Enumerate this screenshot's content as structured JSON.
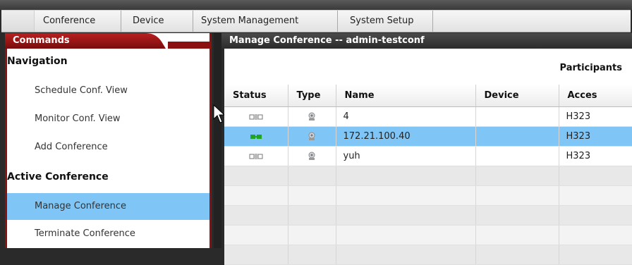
{
  "menu": {
    "items": [
      "Conference",
      "Device",
      "System Management",
      "System Setup"
    ]
  },
  "commands": {
    "title": "Commands",
    "sections": [
      {
        "heading": "Navigation"
      },
      {
        "heading": "Active Conference"
      }
    ],
    "nav_items": [
      "Schedule Conf. View",
      "Monitor Conf. View",
      "Add Conference"
    ],
    "active_items": [
      "Manage Conference",
      "Terminate Conference"
    ],
    "selected_item": "Manage Conference"
  },
  "main": {
    "title": "Manage Conference -- admin-testconf",
    "group_header": "Participants",
    "columns": [
      "Status",
      "Type",
      "Name",
      "Device",
      "Acces"
    ],
    "rows": [
      {
        "status": "disconnected",
        "type": "terminal-icon",
        "name": "4",
        "device": "",
        "access": "H323",
        "selected": false
      },
      {
        "status": "connected",
        "type": "terminal-icon",
        "name": "172.21.100.40",
        "device": "",
        "access": "H323",
        "selected": true
      },
      {
        "status": "disconnected",
        "type": "terminal-icon",
        "name": "yuh",
        "device": "",
        "access": "H323",
        "selected": false
      }
    ]
  },
  "colors": {
    "accent": "#8b1010",
    "selection": "#7fc6f6",
    "connected": "#1fa51f",
    "disconnected": "#777777"
  }
}
